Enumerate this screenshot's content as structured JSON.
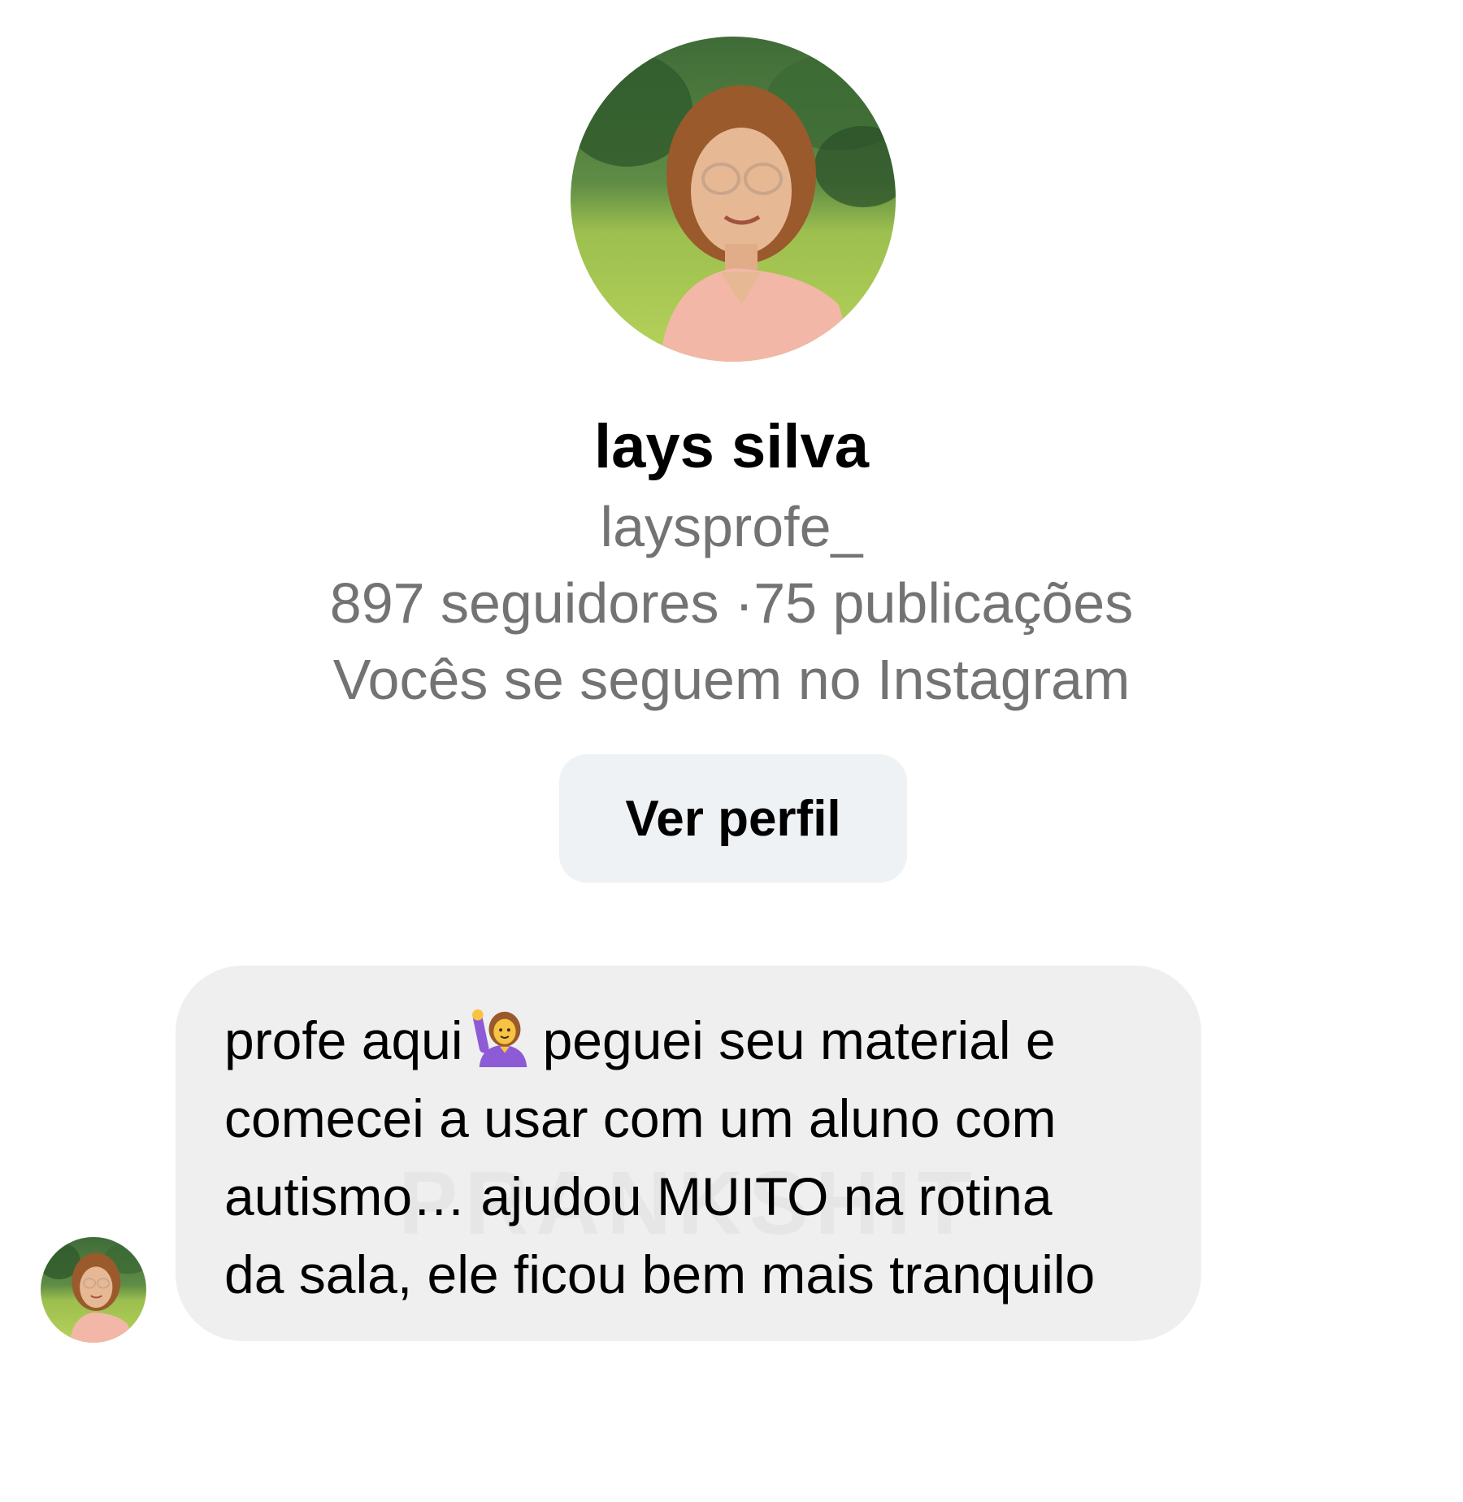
{
  "profile": {
    "avatar_icon": "profile-photo",
    "display_name": "lays silva",
    "username": "laysprofe_",
    "stats": "897 seguidores ·75 publicações",
    "mutual_follow": "Vocês se seguem no Instagram",
    "view_profile_label": "Ver perfil"
  },
  "message": {
    "sender_avatar_icon": "profile-photo",
    "line1_before_emoji": "profe aqui",
    "emoji": "person-raising-hand-emoji",
    "line1_after_emoji": "peguei seu material e",
    "line2": "comecei a usar com um aluno com",
    "line3": "autismo… ajudou MUITO na rotina",
    "line4": "da sala, ele ficou bem mais tranquilo",
    "watermark": "PRANKSHIT"
  },
  "colors": {
    "secondary_text": "#737373",
    "button_bg": "#eff2f5",
    "bubble_bg": "#efefef"
  }
}
